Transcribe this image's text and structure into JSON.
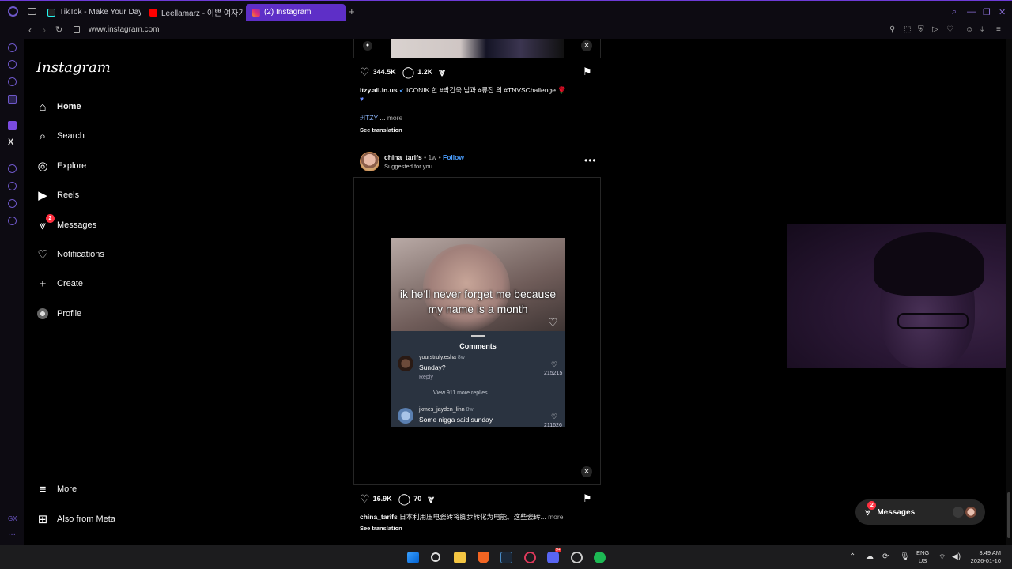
{
  "browser": {
    "tabs": [
      {
        "label": "TikTok - Make Your Day",
        "color": "#111111"
      },
      {
        "label": "Leellamarz - 이쁜 여자가",
        "color": "#ff0000"
      },
      {
        "label": "(2) Instagram",
        "color": "#c13584"
      }
    ],
    "url": "www.instagram.com"
  },
  "sidebar": {
    "logo": "Instagram",
    "items": [
      {
        "label": "Home",
        "icon": "home-icon"
      },
      {
        "label": "Search",
        "icon": "search-icon"
      },
      {
        "label": "Explore",
        "icon": "compass-icon"
      },
      {
        "label": "Reels",
        "icon": "reels-icon"
      },
      {
        "label": "Messages",
        "icon": "messenger-icon",
        "badge": "2"
      },
      {
        "label": "Notifications",
        "icon": "heart-icon"
      },
      {
        "label": "Create",
        "icon": "plus-icon"
      },
      {
        "label": "Profile",
        "icon": "avatar-icon"
      }
    ],
    "more": "More",
    "meta": "Also from Meta"
  },
  "post1": {
    "likes": "344.5K",
    "comments": "1.2K",
    "caption_user": "itzy.all.in.us",
    "caption_text": "ICONIK 한 #박건욱 님과 #류진 의 #TNVSChallenge 🌹",
    "hashtag": "#ITZY",
    "ellipsis": "...",
    "more": "more",
    "see_translation": "See translation"
  },
  "post2": {
    "username": "china_tarifs",
    "age": "1w",
    "follow": "Follow",
    "suggested": "Suggested for you",
    "overlay_text": "ik he'll never forget me because my name is a month",
    "comments_title": "Comments",
    "comment1": {
      "user": "yourstruly.esha",
      "time": "8w",
      "text": "Sunday?",
      "reply": "Reply",
      "likes": "215215"
    },
    "view_replies": "View 911 more replies",
    "comment2": {
      "user": "jxmes_jayden_linn",
      "time": "8w",
      "text": "Some nigga said sunday",
      "likes": "211626"
    },
    "likes": "16.9K",
    "comments": "70",
    "caption_user": "china_tarifs",
    "caption_text": "日本利用压电瓷砖将脚步转化为电能。这些瓷砖...",
    "more": "more",
    "see_translation": "See translation"
  },
  "messages_pill": {
    "label": "Messages",
    "badge": "2"
  },
  "taskbar": {
    "lang_top": "ENG",
    "lang_bottom": "US",
    "time": "3:49 AM",
    "date": "2026-01-10",
    "discord_badge": "9+"
  },
  "opera_gx": "GX",
  "colors": {
    "accent": "#5e2fc7",
    "link": "#4a9eff",
    "badge": "#ff3040"
  }
}
